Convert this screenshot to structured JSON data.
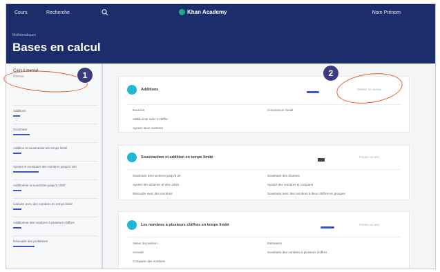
{
  "topbar": {
    "nav_left": "Cours",
    "nav_mid": "Recherche",
    "logo_text": "Khan Academy",
    "user_label": "Nom Prénom"
  },
  "hero": {
    "breadcrumb": "Mathématiques",
    "title": "Bases en calcul"
  },
  "sidebar": {
    "head_title": "Calcul mental",
    "head_sub": "Niveau",
    "items": [
      {
        "label": "Additions",
        "progress": 0
      },
      {
        "label": "Soustraire",
        "progress": 0.2
      },
      {
        "label": "Addition et soustraction en temps limité",
        "progress": 0.1
      },
      {
        "label": "Ajouter et soustraire des nombres jusqu'à 100",
        "progress": 0.3
      },
      {
        "label": "Additionner et soustraire jusqu'à 1000",
        "progress": 0.1
      },
      {
        "label": "Calculer avec des nombres en temps limité",
        "progress": 0.1
      },
      {
        "label": "Additionner des nombres à plusieurs chiffres",
        "progress": 0.1
      },
      {
        "label": "Résoudre des problèmes",
        "progress": 0.25
      }
    ]
  },
  "cards": [
    {
      "title": "Additions",
      "action": "Obtenir ce niveau",
      "rows_left": [
        "Exercice",
        "Additionner avec 1 chiffre",
        "Ajouter deux nombres"
      ],
      "rows_right": [
        "Commencer l'unité"
      ]
    },
    {
      "title": "Soustraction et addition en temps limité",
      "action": "Passer au test",
      "rows_left": [
        "Soustraire des nombres jusqu'à 20",
        "Ajouter des dizaines et des unités",
        "Résoudre avec des nombres"
      ],
      "rows_right": [
        "Soustraire des dizaines",
        "Ajouter des nombres et comparer",
        "Soustraire avec des nombres à deux chiffres en groupes"
      ]
    },
    {
      "title": "Les nombres à plusieurs chiffres en temps limité",
      "action": "Passer au test",
      "rows_left": [
        "Valeur de position",
        "Arrondir",
        "Comparer des nombres"
      ],
      "rows_right": [
        "Estimation",
        "Soustraire des nombres à plusieurs chiffres"
      ]
    }
  ],
  "markers": {
    "m1": "1",
    "m2": "2"
  },
  "colors": {
    "nav": "#1c2d6b",
    "accent": "#3a56c7",
    "badge": "#1fb7d6",
    "annotation": "#e85a2a"
  }
}
